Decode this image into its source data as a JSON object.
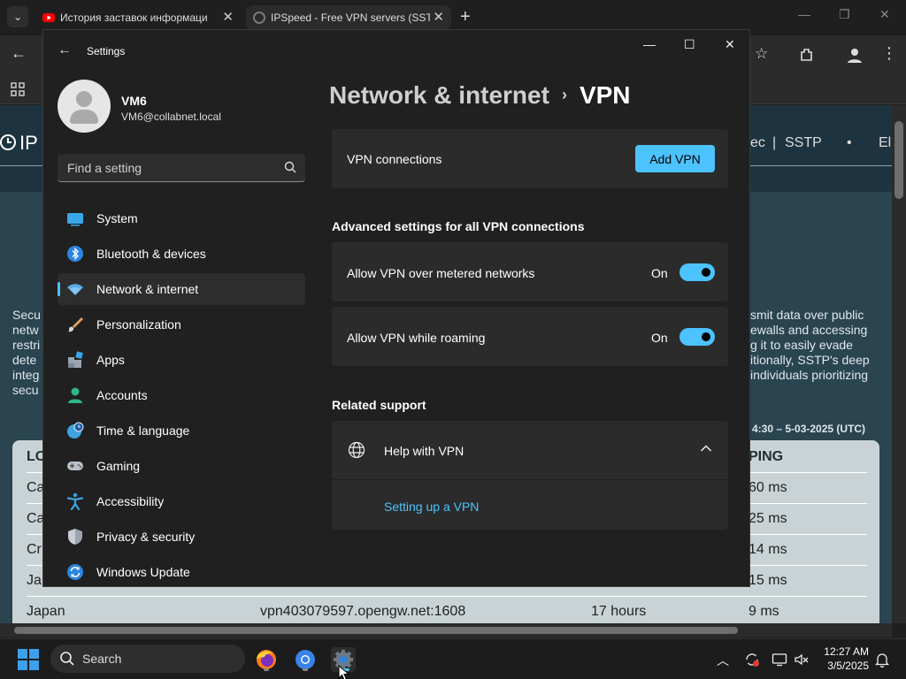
{
  "browser": {
    "tabs": [
      {
        "title": "История заставок информаци"
      },
      {
        "title": "IPSpeed - Free VPN servers (SST"
      }
    ],
    "new_tab": "+"
  },
  "webpage": {
    "brand": "IP",
    "protocols_visible": [
      "ec",
      "|",
      "SSTP",
      "•",
      "El"
    ],
    "para_left": [
      "Secu",
      "netw",
      "restri",
      "dete",
      "integ",
      "secu"
    ],
    "para_right": [
      "smit data over public",
      "ewalls and accessing",
      "g it to easily evade",
      "itionally, SSTP's deep",
      "individuals prioritizing"
    ],
    "updated": "4:30 – 5-03-2025 (UTC)",
    "table": {
      "headers": {
        "left": "LO",
        "right": "PING"
      },
      "rows": [
        {
          "loc": "Ca",
          "ping": "60 ms"
        },
        {
          "loc": "Ca",
          "ping": "25 ms"
        },
        {
          "loc": "Cr",
          "ping": "14 ms"
        },
        {
          "loc": "Ja",
          "ping": "15 ms"
        }
      ],
      "last_row": {
        "loc": "Japan",
        "host": "vpn403079597.opengw.net:1608",
        "uptime": "17 hours",
        "ping": "9 ms"
      }
    }
  },
  "settings": {
    "title": "Settings",
    "user": {
      "name": "VM6",
      "email": "VM6@collabnet.local"
    },
    "search_placeholder": "Find a setting",
    "nav": [
      {
        "label": "System",
        "icon": "system-icon",
        "selected": false
      },
      {
        "label": "Bluetooth & devices",
        "icon": "bluetooth-icon",
        "selected": false
      },
      {
        "label": "Network & internet",
        "icon": "network-icon",
        "selected": true
      },
      {
        "label": "Personalization",
        "icon": "brush-icon",
        "selected": false
      },
      {
        "label": "Apps",
        "icon": "apps-icon",
        "selected": false
      },
      {
        "label": "Accounts",
        "icon": "accounts-icon",
        "selected": false
      },
      {
        "label": "Time & language",
        "icon": "globe-clock-icon",
        "selected": false
      },
      {
        "label": "Gaming",
        "icon": "gamepad-icon",
        "selected": false
      },
      {
        "label": "Accessibility",
        "icon": "accessibility-icon",
        "selected": false
      },
      {
        "label": "Privacy & security",
        "icon": "shield-icon",
        "selected": false
      },
      {
        "label": "Windows Update",
        "icon": "update-icon",
        "selected": false
      }
    ],
    "breadcrumb": {
      "parent": "Network & internet",
      "separator": "›",
      "current": "VPN"
    },
    "vpn_connections": {
      "label": "VPN connections",
      "button": "Add VPN"
    },
    "advanced": {
      "heading": "Advanced settings for all VPN connections",
      "toggles": [
        {
          "label": "Allow VPN over metered networks",
          "state": "On",
          "on": true
        },
        {
          "label": "Allow VPN while roaming",
          "state": "On",
          "on": true
        }
      ]
    },
    "related": {
      "heading": "Related support",
      "help_title": "Help with VPN",
      "link": "Setting up a VPN",
      "expanded": true
    }
  },
  "taskbar": {
    "search_label": "Search",
    "time": "12:27 AM",
    "date": "3/5/2025",
    "apps": [
      "firefox-icon",
      "chrome-icon",
      "settings-gear-icon"
    ]
  },
  "colors": {
    "accent": "#4cc2ff",
    "settings_bg": "#202020",
    "card_bg": "#2b2b2b",
    "web_bg": "#2a4450"
  }
}
